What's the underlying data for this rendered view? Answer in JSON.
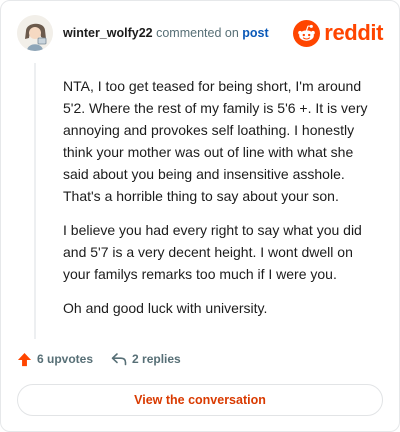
{
  "comment": {
    "username": "winter_wolfy22",
    "action_text": "commented on",
    "post_link": "post",
    "paragraphs": [
      "NTA, I too get teased for being short, I'm around 5'2. Where the rest of my family is 5'6 +. It is very annoying and provokes self loathing. I honestly think your mother was out of line with what she said about you being and insensitive asshole. That's a horrible thing to say about your son.",
      "I believe you had every right to say what you did and 5'7 is a very decent height. I wont dwell on your familys remarks too much if I were you.",
      "Oh and good luck with university."
    ]
  },
  "brand": {
    "wordmark": "reddit",
    "icon": "reddit-snoo-icon",
    "color": "#ff4500"
  },
  "footer": {
    "upvotes": "6 upvotes",
    "replies": "2 replies",
    "view_button": "View the conversation"
  },
  "colors": {
    "accent": "#ff4500",
    "link": "#0a59b8",
    "muted": "#576f76",
    "button_text": "#d93a00"
  }
}
